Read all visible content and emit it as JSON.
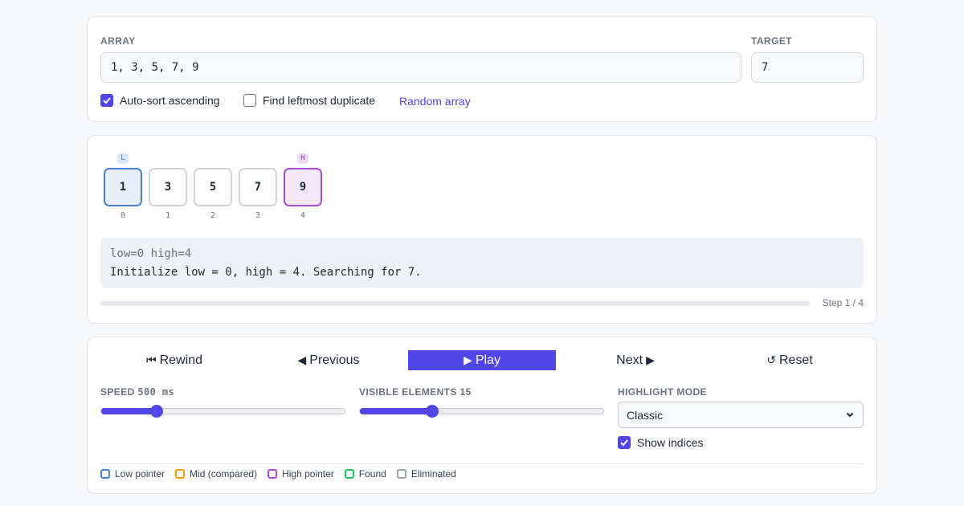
{
  "inputs": {
    "array_label": "ARRAY",
    "array_value": "1, 3, 5, 7, 9",
    "target_label": "TARGET",
    "target_value": "7",
    "auto_sort": {
      "label": "Auto-sort ascending",
      "checked": true
    },
    "leftmost": {
      "label": "Find leftmost duplicate",
      "checked": false
    },
    "random_label": "Random array"
  },
  "viz": {
    "cells": [
      {
        "value": "1",
        "index": "0",
        "state": "low",
        "pointer": "L"
      },
      {
        "value": "3",
        "index": "1",
        "state": "",
        "pointer": ""
      },
      {
        "value": "5",
        "index": "2",
        "state": "",
        "pointer": ""
      },
      {
        "value": "7",
        "index": "3",
        "state": "",
        "pointer": ""
      },
      {
        "value": "9",
        "index": "4",
        "state": "high",
        "pointer": "H"
      }
    ],
    "log_state": "low=0 high=4",
    "log_message": "Initialize low = 0, high = 4. Searching for 7.",
    "step_label": "Step 1 / 4",
    "progress": 0
  },
  "controls": {
    "rewind": {
      "icon": "⏮",
      "label": "Rewind"
    },
    "previous": {
      "icon": "◀",
      "label": "Previous"
    },
    "play": {
      "icon": "▶",
      "label": "Play"
    },
    "next": {
      "icon": "▶",
      "label": "Next"
    },
    "reset": {
      "icon": "↺",
      "label": "Reset"
    },
    "speed": {
      "label": "SPEED",
      "value": "500 ms",
      "fraction": 0.227
    },
    "visible": {
      "label": "VISIBLE ELEMENTS",
      "value": "15",
      "fraction": 0.297
    },
    "highlight": {
      "label": "HIGHLIGHT MODE",
      "selected": "Classic"
    },
    "show_indices": {
      "label": "Show indices",
      "checked": true
    }
  },
  "legend": [
    {
      "label": "Low pointer",
      "color": "#4a7fd8"
    },
    {
      "label": "Mid (compared)",
      "color": "#f59e0b"
    },
    {
      "label": "High pointer",
      "color": "#a84bd6"
    },
    {
      "label": "Found",
      "color": "#22c55e"
    },
    {
      "label": "Eliminated",
      "color": "#9ca3af"
    }
  ],
  "colors": {
    "accent": "#4f46e5",
    "low": "#4a7fd8",
    "high": "#a84bd6"
  }
}
